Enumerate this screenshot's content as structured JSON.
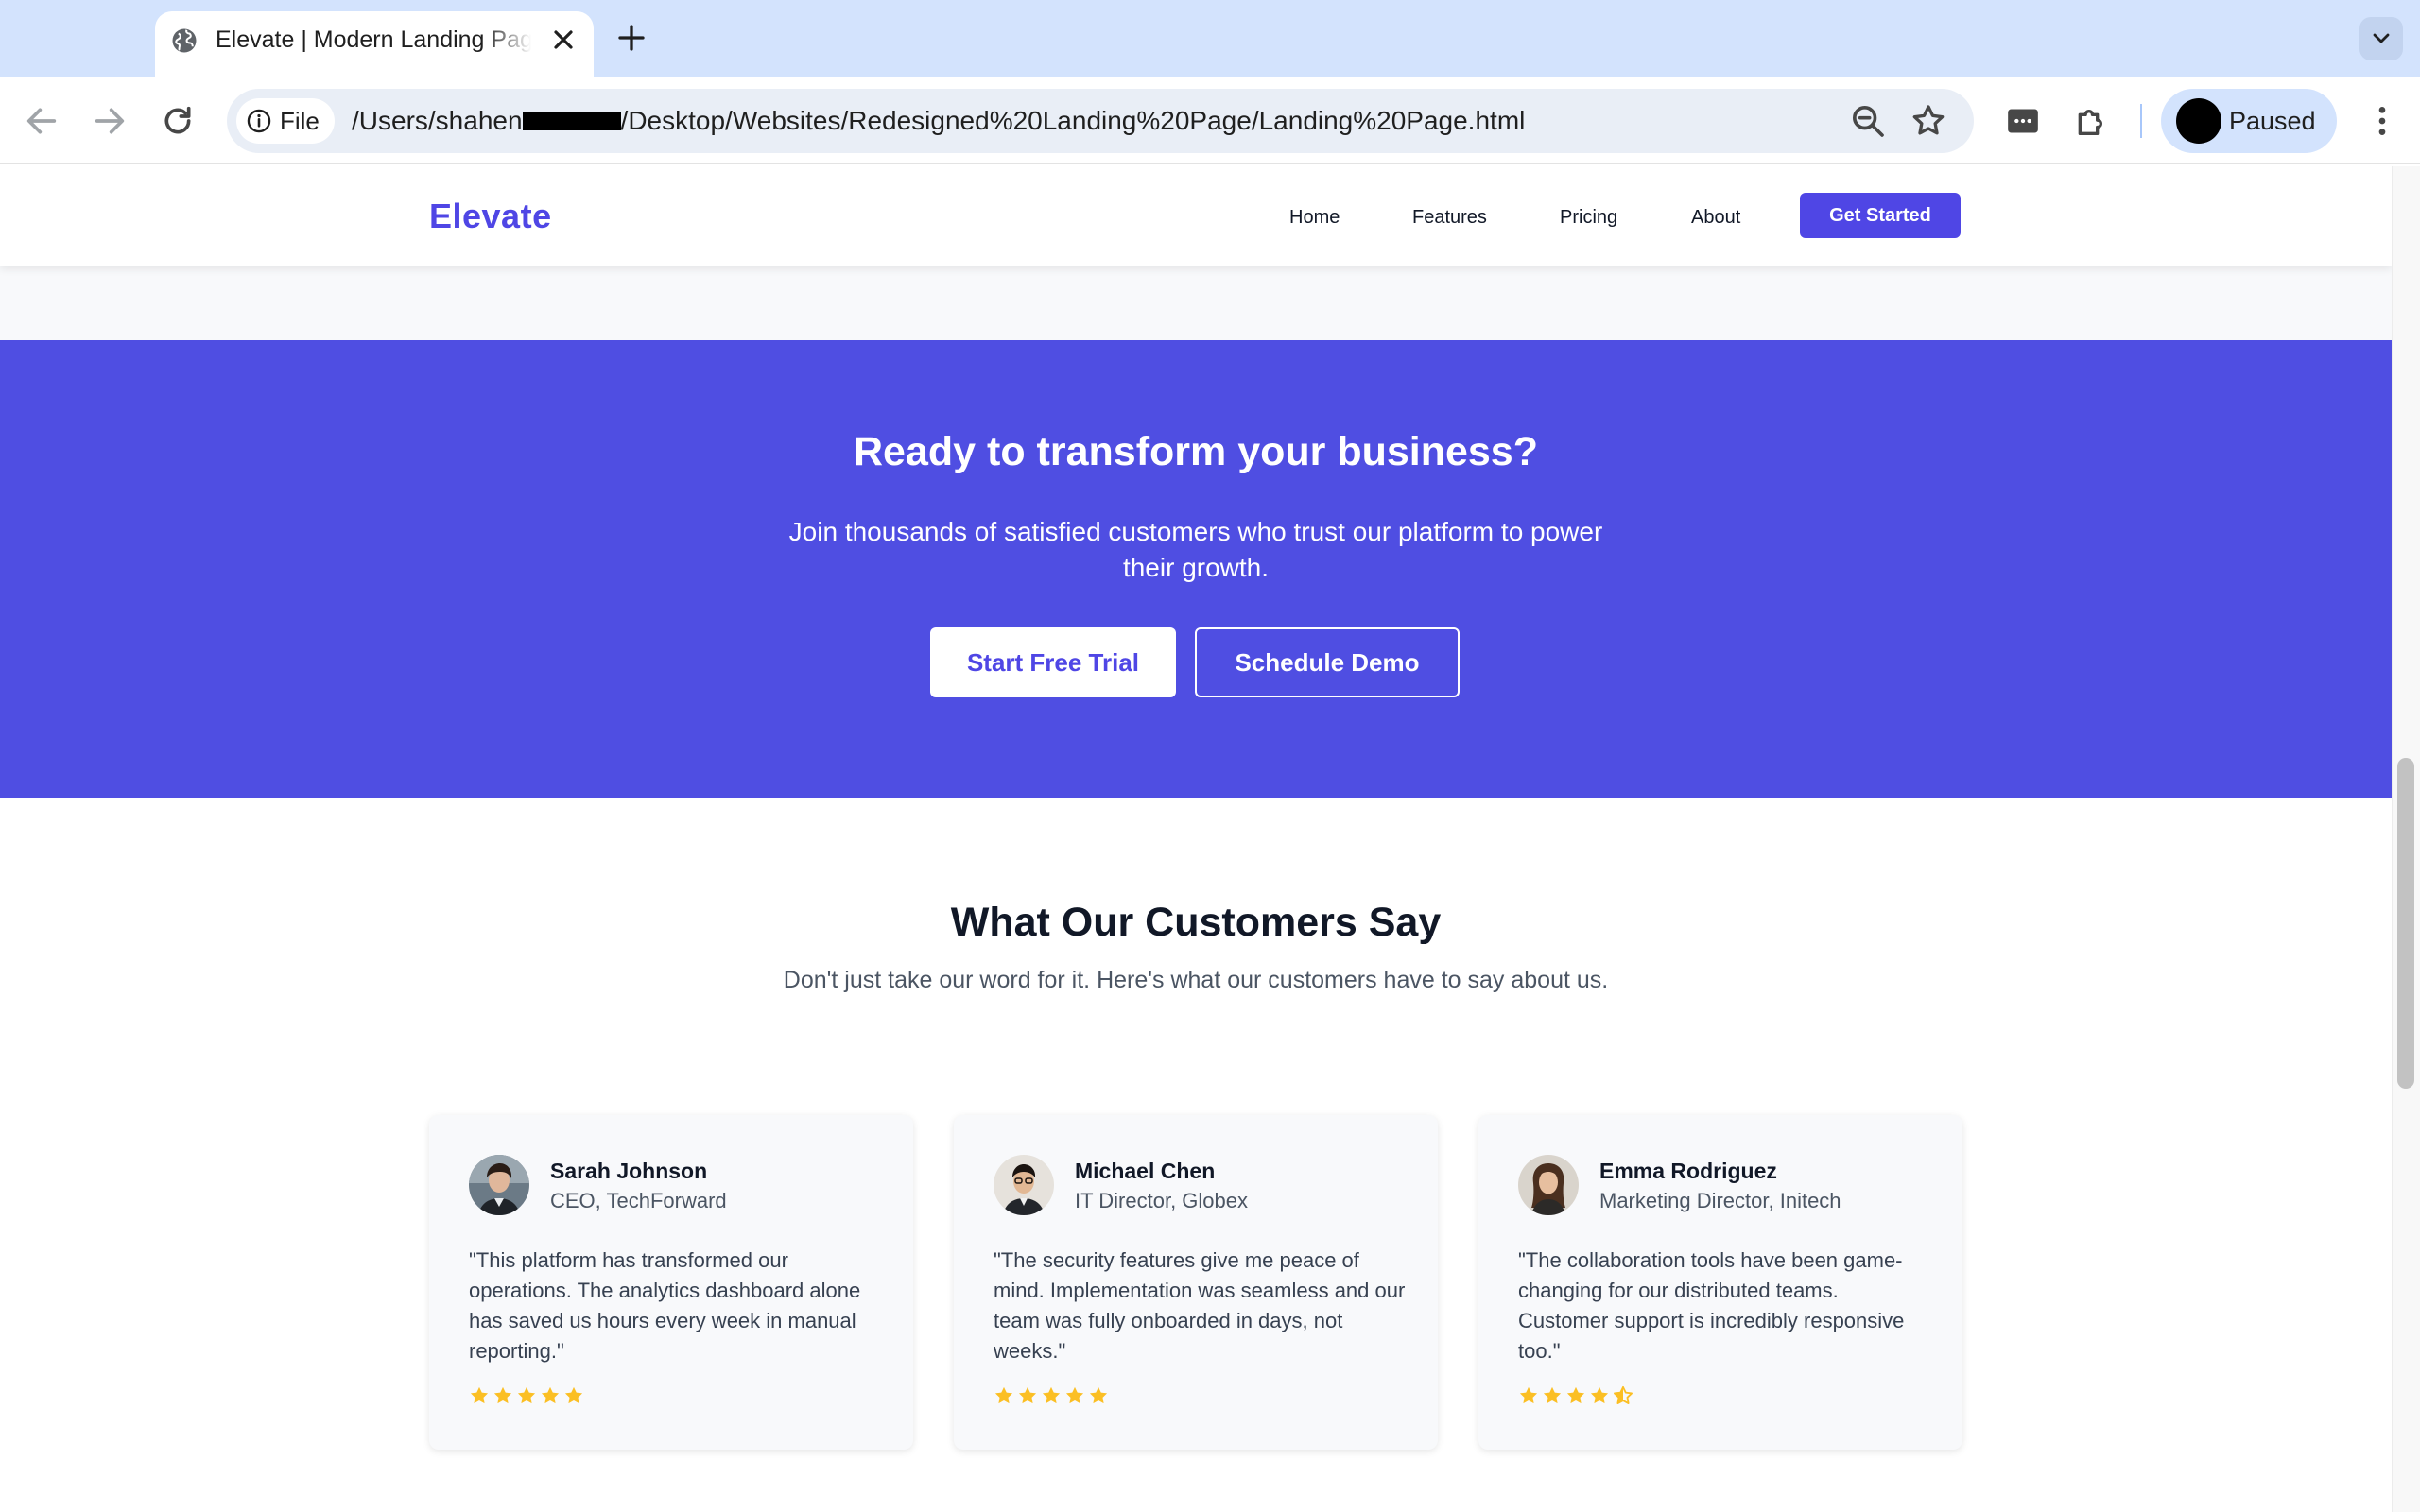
{
  "browser": {
    "tab_title": "Elevate | Modern Landing Page",
    "chip_label": "File",
    "url_prefix": "/Users/shahen",
    "url_suffix": "/Desktop/Websites/Redesigned%20Landing%20Page/Landing%20Page.html",
    "profile_label": "Paused"
  },
  "site": {
    "brand": "Elevate",
    "nav": [
      "Home",
      "Features",
      "Pricing",
      "About"
    ],
    "nav_cta": "Get Started"
  },
  "cta": {
    "title": "Ready to transform your business?",
    "subtitle": "Join thousands of satisfied customers who trust our platform to power their growth.",
    "primary_button": "Start Free Trial",
    "secondary_button": "Schedule Demo"
  },
  "testimonials": {
    "title": "What Our Customers Say",
    "subtitle": "Don't just take our word for it. Here's what our customers have to say about us.",
    "items": [
      {
        "name": "Sarah Johnson",
        "role": "CEO, TechForward",
        "quote": "\"This platform has transformed our operations. The analytics dashboard alone has saved us hours every week in manual reporting.\"",
        "rating": 5
      },
      {
        "name": "Michael Chen",
        "role": "IT Director, Globex",
        "quote": "\"The security features give me peace of mind. Implementation was seamless and our team was fully onboarded in days, not weeks.\"",
        "rating": 5
      },
      {
        "name": "Emma Rodriguez",
        "role": "Marketing Director, Initech",
        "quote": "\"The collaboration tools have been game-changing for our distributed teams. Customer support is incredibly responsive too.\"",
        "rating": 4.5
      }
    ]
  },
  "colors": {
    "accent": "#4f46e5",
    "cta_background": "#4f4ee2",
    "star": "#fbbf24",
    "browser_frame": "#d3e3fd"
  },
  "icons": [
    "globe-icon",
    "close-icon",
    "plus-icon",
    "chevron-down-icon",
    "back-arrow-icon",
    "forward-arrow-icon",
    "reload-icon",
    "info-icon",
    "zoom-icon",
    "bookmark-star-icon",
    "password-manager-icon",
    "extensions-puzzle-icon",
    "kebab-menu-icon",
    "star-icon",
    "half-star-icon"
  ]
}
